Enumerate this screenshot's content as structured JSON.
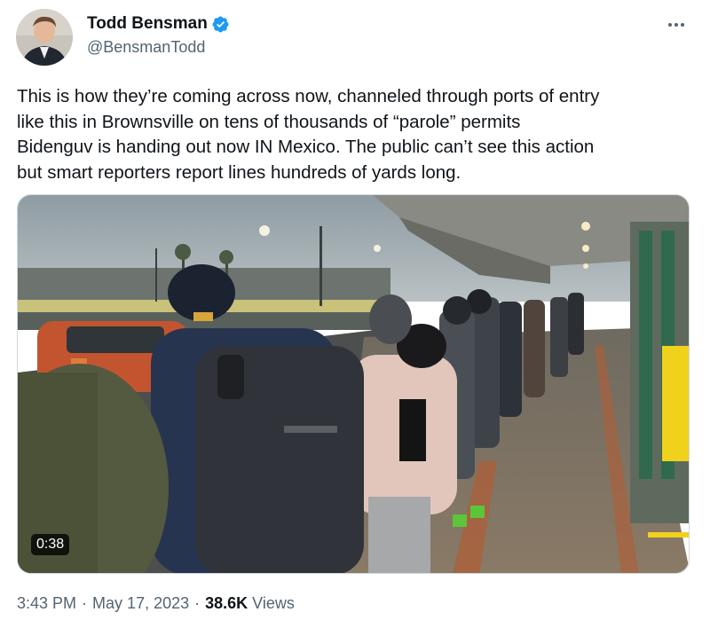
{
  "author": {
    "display_name": "Todd Bensman",
    "handle": "@BensmanTodd",
    "verified": true,
    "verified_color": "#1d9bf0"
  },
  "tweet": {
    "text": "This is how they’re coming across now, channeled through ports of entry\nlike this in Brownsville on tens of thousands of “parole” permits\nBidenguv is handing out now IN Mexico. The public can’t see this action\nbut smart reporters report lines hundreds of yards long."
  },
  "media": {
    "type": "video",
    "duration": "0:38"
  },
  "meta": {
    "time": "3:43 PM",
    "separator": "·",
    "date": "May 17, 2023",
    "views_count": "38.6K",
    "views_label": "Views"
  },
  "icons": {
    "more": "more-dots-icon",
    "verified": "verified-badge-icon"
  }
}
